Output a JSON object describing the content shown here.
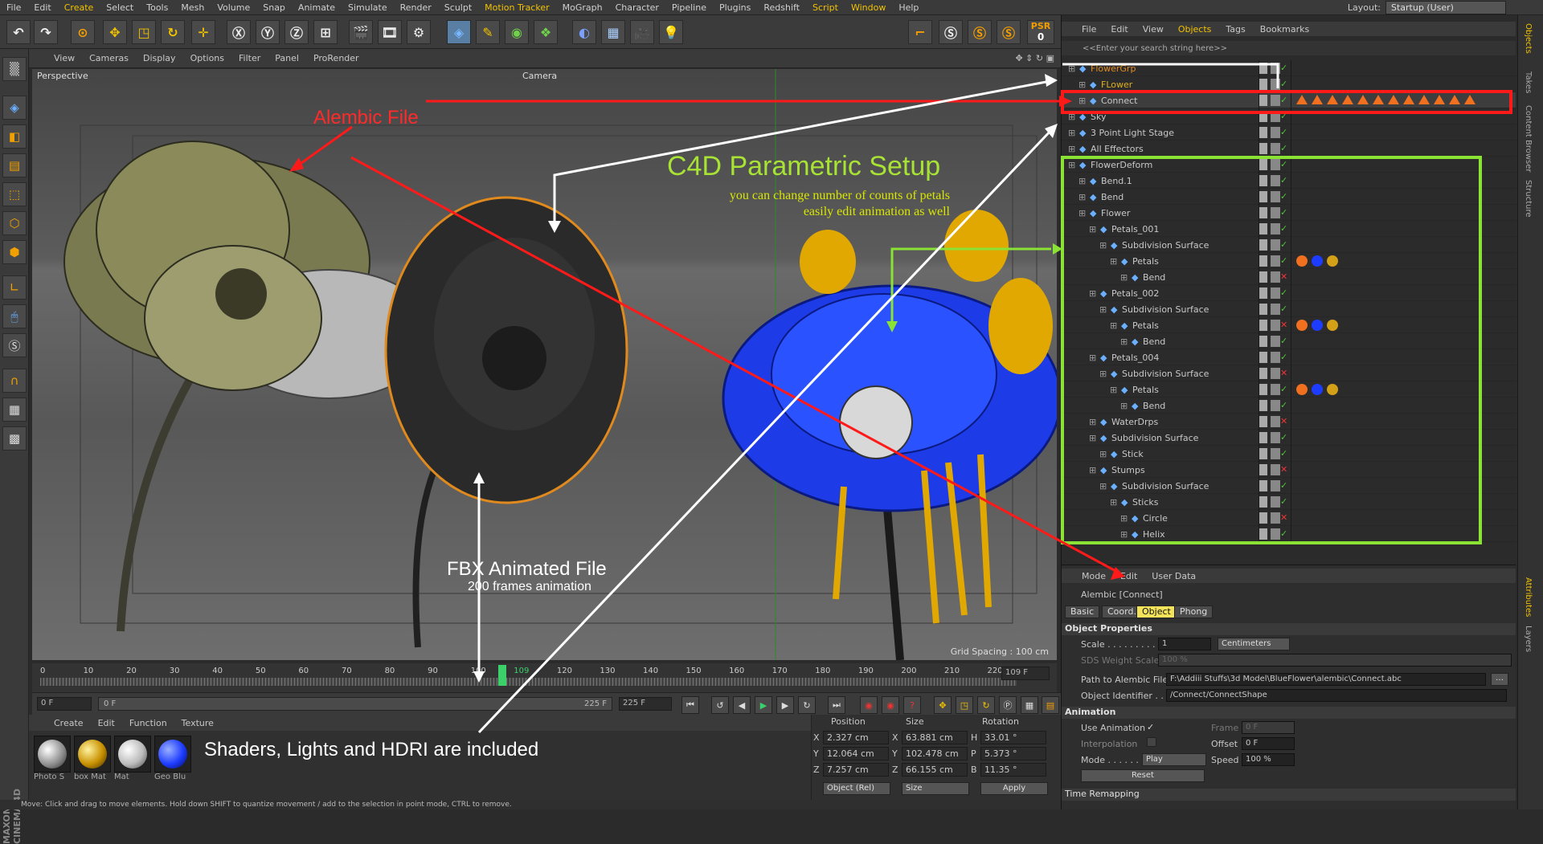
{
  "menubar": {
    "items": [
      "File",
      "Edit",
      "Create",
      "Select",
      "Tools",
      "Mesh",
      "Volume",
      "Snap",
      "Animate",
      "Simulate",
      "Render",
      "Sculpt",
      "Motion Tracker",
      "MoGraph",
      "Character",
      "Pipeline",
      "Plugins",
      "Redshift",
      "Script",
      "Window",
      "Help"
    ],
    "layout_label": "Layout:",
    "layout_value": "Startup (User)"
  },
  "toolbar": {
    "psr_label": "PSR",
    "psr_value": "0"
  },
  "viewport": {
    "menu": [
      "View",
      "Cameras",
      "Display",
      "Options",
      "Filter",
      "Panel",
      "ProRender"
    ],
    "label": "Perspective",
    "camera_label": "Camera",
    "grid_spacing": "Grid Spacing : 100 cm"
  },
  "timeline": {
    "ticks": [
      "0",
      "10",
      "20",
      "30",
      "40",
      "50",
      "60",
      "70",
      "80",
      "90",
      "100",
      "109",
      "120",
      "130",
      "140",
      "150",
      "160",
      "170",
      "180",
      "190",
      "200",
      "210",
      "220"
    ],
    "current": "109 F"
  },
  "transport": {
    "start": "0 F",
    "min": "0 F",
    "max": "225 F",
    "end": "225 F"
  },
  "materials": {
    "tabs": [
      "Create",
      "Edit",
      "Function",
      "Texture"
    ],
    "items": [
      {
        "name": "Photo S",
        "color": "#ffffff"
      },
      {
        "name": "box Mat",
        "color": "#d4a017"
      },
      {
        "name": "Mat",
        "color": "#d8d8d8"
      },
      {
        "name": "Geo Blu",
        "color": "#1e3cff"
      }
    ]
  },
  "coords": {
    "headers": [
      "Position",
      "Size",
      "Rotation"
    ],
    "rows": [
      {
        "axis": "X",
        "pos": "2.327 cm",
        "size_axis": "X",
        "size": "63.881 cm",
        "rot_axis": "H",
        "rot": "33.01 °"
      },
      {
        "axis": "Y",
        "pos": "12.064 cm",
        "size_axis": "Y",
        "size": "102.478 cm",
        "rot_axis": "P",
        "rot": "5.373 °"
      },
      {
        "axis": "Z",
        "pos": "7.257 cm",
        "size_axis": "Z",
        "size": "66.155 cm",
        "rot_axis": "B",
        "rot": "11.35 °"
      }
    ],
    "mode": "Object (Rel)",
    "size_mode": "Size",
    "apply": "Apply"
  },
  "status": "Move: Click and drag to move elements. Hold down SHIFT to quantize movement / add to the selection in point mode, CTRL to remove.",
  "objects": {
    "menu": [
      "File",
      "Edit",
      "View",
      "Objects",
      "Tags",
      "Bookmarks"
    ],
    "search_placeholder": "<<Enter your search string here>>",
    "rows": [
      {
        "name": "FlowerGrp",
        "indent": 0,
        "color": "#e08a1e"
      },
      {
        "name": "FLower",
        "indent": 1,
        "color": "#e0b01e"
      },
      {
        "name": "Connect",
        "indent": 1,
        "color": "#c8c8c8"
      },
      {
        "name": "Sky",
        "indent": 0,
        "color": "#c8c8c8"
      },
      {
        "name": "3 Point Light Stage",
        "indent": 0,
        "color": "#c8c8c8"
      },
      {
        "name": "All Effectors",
        "indent": 0,
        "color": "#c8c8c8"
      },
      {
        "name": "FlowerDeform",
        "indent": 0,
        "color": "#c8c8c8"
      },
      {
        "name": "Bend.1",
        "indent": 1,
        "color": "#c8c8c8"
      },
      {
        "name": "Bend",
        "indent": 1,
        "color": "#c8c8c8"
      },
      {
        "name": "Flower",
        "indent": 1,
        "color": "#c8c8c8"
      },
      {
        "name": "Petals_001",
        "indent": 2,
        "color": "#c8c8c8"
      },
      {
        "name": "Subdivision Surface",
        "indent": 3,
        "color": "#c8c8c8"
      },
      {
        "name": "Petals",
        "indent": 4,
        "color": "#c8c8c8"
      },
      {
        "name": "Bend",
        "indent": 5,
        "color": "#c8c8c8"
      },
      {
        "name": "Petals_002",
        "indent": 2,
        "color": "#c8c8c8"
      },
      {
        "name": "Subdivision Surface",
        "indent": 3,
        "color": "#c8c8c8"
      },
      {
        "name": "Petals",
        "indent": 4,
        "color": "#c8c8c8"
      },
      {
        "name": "Bend",
        "indent": 5,
        "color": "#c8c8c8"
      },
      {
        "name": "Petals_004",
        "indent": 2,
        "color": "#c8c8c8"
      },
      {
        "name": "Subdivision Surface",
        "indent": 3,
        "color": "#c8c8c8"
      },
      {
        "name": "Petals",
        "indent": 4,
        "color": "#c8c8c8"
      },
      {
        "name": "Bend",
        "indent": 5,
        "color": "#c8c8c8"
      },
      {
        "name": "WaterDrps",
        "indent": 2,
        "color": "#c8c8c8"
      },
      {
        "name": "Subdivision Surface",
        "indent": 2,
        "color": "#c8c8c8"
      },
      {
        "name": "Stick",
        "indent": 3,
        "color": "#c8c8c8"
      },
      {
        "name": "Stumps",
        "indent": 2,
        "color": "#c8c8c8"
      },
      {
        "name": "Subdivision Surface",
        "indent": 3,
        "color": "#c8c8c8"
      },
      {
        "name": "Sticks",
        "indent": 4,
        "color": "#c8c8c8"
      },
      {
        "name": "Circle",
        "indent": 5,
        "color": "#c8c8c8"
      },
      {
        "name": "Helix",
        "indent": 5,
        "color": "#c8c8c8"
      }
    ]
  },
  "attributes": {
    "menu": [
      "Mode",
      "Edit",
      "User Data"
    ],
    "title": "Alembic [Connect]",
    "tabs": [
      "Basic",
      "Coord.",
      "Object",
      "Phong"
    ],
    "active_tab": "Object",
    "section_object": "Object Properties",
    "scale_label": "Scale . . . . . . . . .",
    "scale_value": "1",
    "scale_unit": "Centimeters",
    "sds_label": "SDS Weight Scale",
    "sds_value": "100 %",
    "path_label": "Path to Alembic File",
    "path_value": "F:\\Addiii Stuffs\\3d Model\\BlueFlower\\alembic\\Connect.abc",
    "ident_label": "Object Identifier . . .",
    "ident_value": "/Connect/ConnectShape",
    "section_anim": "Animation",
    "use_anim_label": "Use Animation",
    "frame_label": "Frame",
    "frame_value": "0 F",
    "interp_label": "Interpolation",
    "offset_label": "Offset",
    "offset_value": "0 F",
    "mode_label": "Mode . . . . . . .",
    "mode_value": "Play",
    "speed_label": "Speed",
    "speed_value": "100 %",
    "reset": "Reset",
    "time_remap": "Time Remapping"
  },
  "side_tabs": [
    "Objects",
    "Takes",
    "Content Browser",
    "Structure",
    "Attributes",
    "Layers"
  ],
  "annotations": {
    "alembic": "Alembic File",
    "c4d_title": "C4D Parametric Setup",
    "c4d_sub1": "you can change number of counts of petals",
    "c4d_sub2": "easily edit animation as well",
    "fbx_title": "FBX Animated File",
    "fbx_sub": "200 frames animation",
    "shaders": "Shaders, Lights and HDRI are included"
  }
}
